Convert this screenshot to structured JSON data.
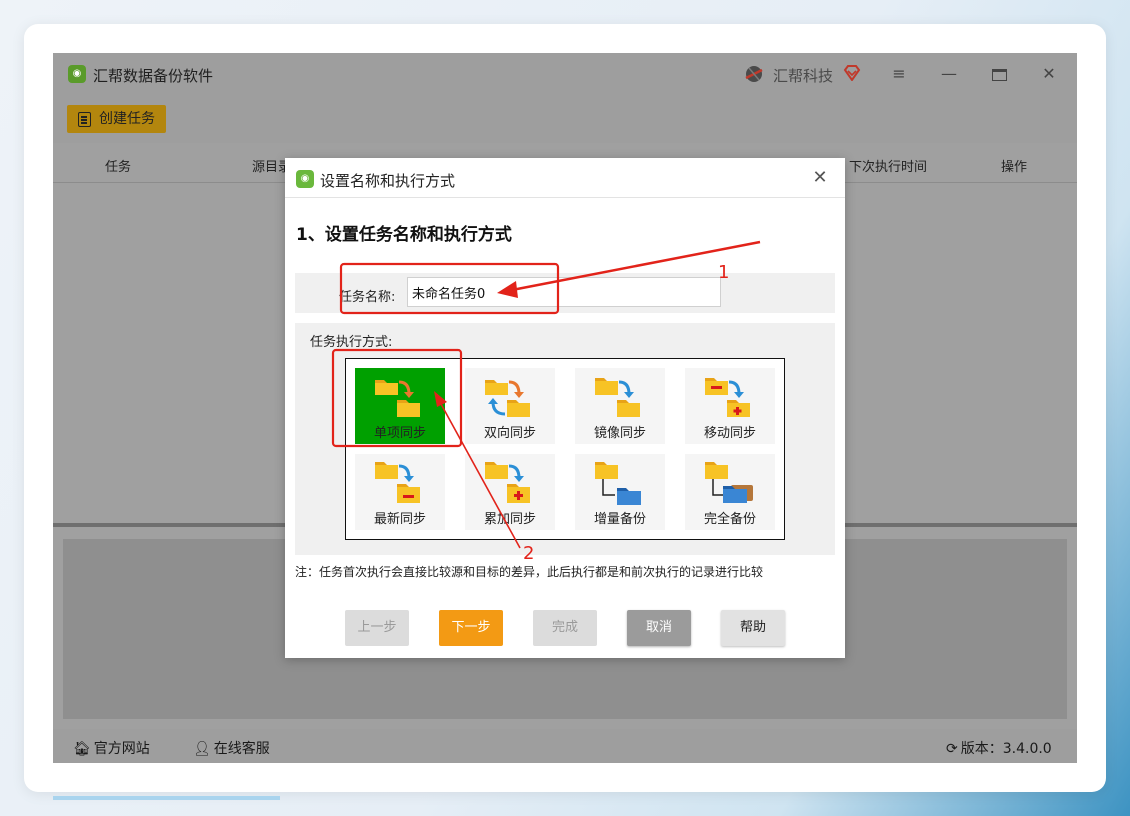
{
  "app": {
    "title": "汇帮数据备份软件",
    "brand_name": "汇帮科技",
    "create_task_label": "创建任务"
  },
  "table_headers": [
    "任务",
    "源目录",
    "下次执行时间",
    "操作"
  ],
  "footer": {
    "website": "官方网站",
    "support": "在线客服",
    "version": "版本：3.4.0.0"
  },
  "dialog": {
    "title": "设置名称和执行方式",
    "section_title": "1、设置任务名称和执行方式",
    "name_label": "任务名称:",
    "name_value": "未命名任务0",
    "mode_label": "任务执行方式:",
    "modes": [
      {
        "label": "单项同步",
        "icon": "one-way-sync-icon",
        "selected": true
      },
      {
        "label": "双向同步",
        "icon": "two-way-sync-icon",
        "selected": false
      },
      {
        "label": "镜像同步",
        "icon": "mirror-sync-icon",
        "selected": false
      },
      {
        "label": "移动同步",
        "icon": "move-sync-icon",
        "selected": false
      },
      {
        "label": "最新同步",
        "icon": "latest-sync-icon",
        "selected": false
      },
      {
        "label": "累加同步",
        "icon": "cumulative-sync-icon",
        "selected": false
      },
      {
        "label": "增量备份",
        "icon": "incremental-backup-icon",
        "selected": false
      },
      {
        "label": "完全备份",
        "icon": "full-backup-icon",
        "selected": false
      }
    ],
    "note": "注：任务首次执行会直接比较源和目标的差异，此后执行都是和前次执行的记录进行比较",
    "buttons": {
      "prev": "上一步",
      "next": "下一步",
      "done": "完成",
      "cancel": "取消",
      "help": "帮助"
    }
  },
  "annotations": {
    "marker_1": "1",
    "marker_2": "2"
  },
  "colors": {
    "selected_mode": "#00a000",
    "next_button": "#f39a14",
    "annotation": "#e2231a"
  }
}
